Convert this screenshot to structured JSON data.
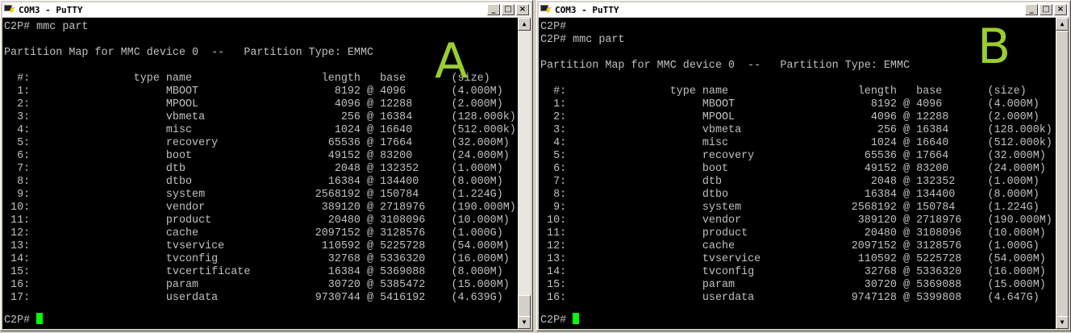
{
  "windows": [
    {
      "title": "COM3 - PuTTY",
      "label": "A",
      "lines": [
        "C2P# mmc part",
        "",
        "Partition Map for MMC device 0  --   Partition Type: EMMC",
        "",
        "  #:                type name                    length   base       (size)",
        "  1:                     MBOOT                     8192 @ 4096       (4.000M)",
        "  2:                     MPOOL                     4096 @ 12288      (2.000M)",
        "  3:                     vbmeta                     256 @ 16384      (128.000k)",
        "  4:                     misc                      1024 @ 16640      (512.000k)",
        "  5:                     recovery                 65536 @ 17664      (32.000M)",
        "  6:                     boot                     49152 @ 83200      (24.000M)",
        "  7:                     dtb                       2048 @ 132352     (1.000M)",
        "  8:                     dtbo                     16384 @ 134400     (8.000M)",
        "  9:                     system                 2568192 @ 150784     (1.224G)",
        " 10:                     vendor                  389120 @ 2718976    (190.000M)",
        " 11:                     product                  20480 @ 3108096    (10.000M)",
        " 12:                     cache                  2097152 @ 3128576    (1.000G)",
        " 13:                     tvservice               110592 @ 5225728    (54.000M)",
        " 14:                     tvconfig                 32768 @ 5336320    (16.000M)",
        " 15:                     tvcertificate            16384 @ 5369088    (8.000M)",
        " 16:                     param                    30720 @ 5385472    (15.000M)",
        " 17:                     userdata               9730744 @ 5416192    (4.639G)"
      ],
      "prompt": "C2P# "
    },
    {
      "title": "COM3 - PuTTY",
      "label": "B",
      "lines": [
        "C2P#",
        "C2P# mmc part",
        "",
        "Partition Map for MMC device 0  --   Partition Type: EMMC",
        "",
        "  #:                type name                    length   base       (size)",
        "  1:                     MBOOT                     8192 @ 4096       (4.000M)",
        "  2:                     MPOOL                     4096 @ 12288      (2.000M)",
        "  3:                     vbmeta                     256 @ 16384      (128.000k)",
        "  4:                     misc                      1024 @ 16640      (512.000k)",
        "  5:                     recovery                 65536 @ 17664      (32.000M)",
        "  6:                     boot                     49152 @ 83200      (24.000M)",
        "  7:                     dtb                       2048 @ 132352     (1.000M)",
        "  8:                     dtbo                     16384 @ 134400     (8.000M)",
        "  9:                     system                 2568192 @ 150784     (1.224G)",
        " 10:                     vendor                  389120 @ 2718976    (190.000M)",
        " 11:                     product                  20480 @ 3108096    (10.000M)",
        " 12:                     cache                  2097152 @ 3128576    (1.000G)",
        " 13:                     tvservice               110592 @ 5225728    (54.000M)",
        " 14:                     tvconfig                 32768 @ 5336320    (16.000M)",
        " 15:                     param                    30720 @ 5369088    (15.000M)",
        " 16:                     userdata               9747128 @ 5399808    (4.647G)"
      ],
      "prompt": "C2P# "
    }
  ],
  "colors": {
    "terminal_bg": "#000000",
    "terminal_fg": "#c0c0c0",
    "cursor": "#00ff00",
    "label": "#9acd32"
  },
  "titlebar_buttons": [
    "minimize",
    "maximize",
    "close"
  ]
}
